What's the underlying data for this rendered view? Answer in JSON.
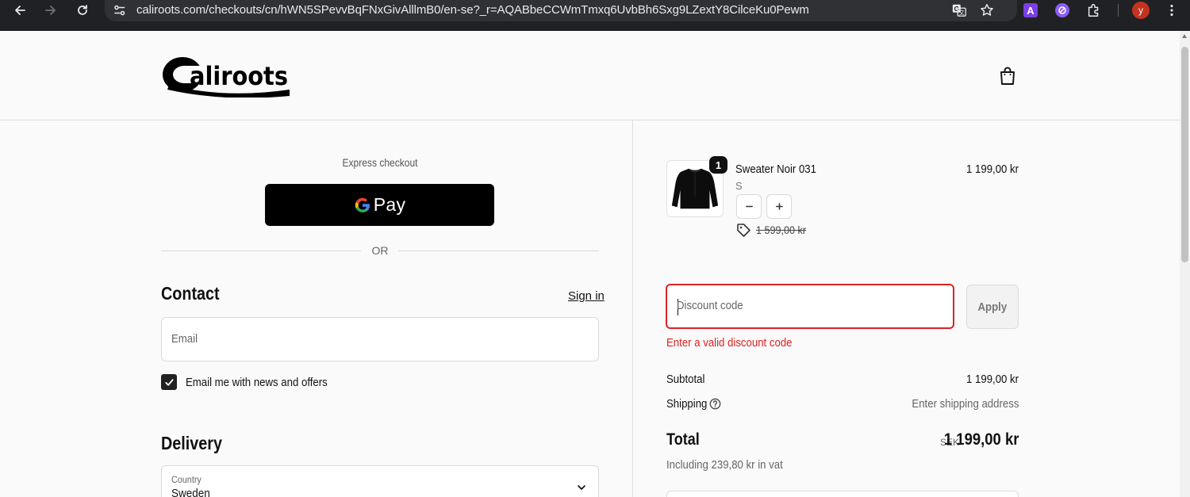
{
  "browser": {
    "url": "caliroots.com/checkouts/cn/hWN5SPevvBqFNxGivAlllmB0/en-se?_r=AQABbeCCWmTmxq6UvbBh6Sxg9LZextY8CilceKu0Pewm",
    "profile_initial": "y",
    "extension_letter": "A"
  },
  "header": {
    "logo_text": "Caliroots"
  },
  "express": {
    "label": "Express checkout",
    "gpay_label": "Pay",
    "or_label": "OR"
  },
  "contact": {
    "heading": "Contact",
    "signin_label": "Sign in",
    "email_placeholder": "Email",
    "newsletter_label": "Email me with news and offers",
    "newsletter_checked": true
  },
  "delivery": {
    "heading": "Delivery",
    "country_label": "Country",
    "country_value": "Sweden"
  },
  "cart": {
    "item": {
      "name": "Sweater Noir 031",
      "variant": "S",
      "quantity": "1",
      "price": "1 199,00 kr",
      "original_price": "1 599,00 kr"
    }
  },
  "discount": {
    "placeholder": "Discount code",
    "apply_label": "Apply",
    "error": "Enter a valid discount code"
  },
  "summary": {
    "subtotal_label": "Subtotal",
    "subtotal_value": "1 199,00 kr",
    "shipping_label": "Shipping",
    "shipping_value": "Enter shipping address",
    "total_label": "Total",
    "total_currency": "SEK",
    "total_value": "1 199,00 kr",
    "vat_note": "Including 239,80 kr in vat"
  },
  "colors": {
    "error": "#dd2222",
    "button_dark": "#000000"
  }
}
